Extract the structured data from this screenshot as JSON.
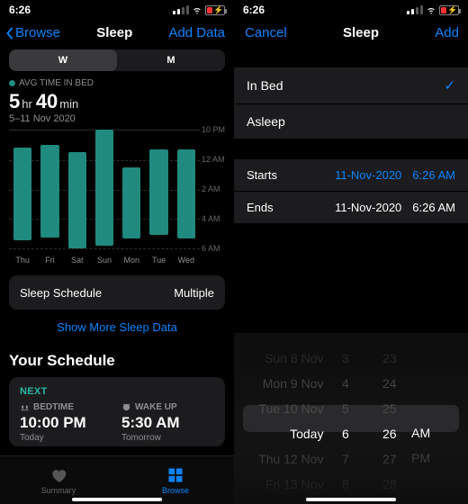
{
  "status": {
    "time": "6:26"
  },
  "left": {
    "nav": {
      "back": "Browse",
      "title": "Sleep",
      "action": "Add Data"
    },
    "seg": {
      "w": "W",
      "m": "M"
    },
    "avg_label": "AVG TIME IN BED",
    "avg_hr": "5",
    "avg_hr_unit": "hr",
    "avg_min": "40",
    "avg_min_unit": "min",
    "range": "5–11 Nov 2020",
    "schedule_row": {
      "label": "Sleep Schedule",
      "value": "Multiple"
    },
    "show_more": "Show More Sleep Data",
    "your_schedule": "Your Schedule",
    "next": "Next",
    "bed_label": "BEDTIME",
    "bed_time": "10:00 PM",
    "bed_sub": "Today",
    "wake_label": "WAKE UP",
    "wake_time": "5:30 AM",
    "wake_sub": "Tomorrow",
    "tabs": {
      "summary": "Summary",
      "browse": "Browse"
    }
  },
  "right": {
    "nav": {
      "cancel": "Cancel",
      "title": "Sleep",
      "action": "Add"
    },
    "opt_inbed": "In Bed",
    "opt_asleep": "Asleep",
    "starts": "Starts",
    "starts_date": "11-Nov-2020",
    "starts_time": "6:26 AM",
    "ends": "Ends",
    "ends_date": "11-Nov-2020",
    "ends_time": "6:26 AM",
    "picker": {
      "days": [
        "Sun 8 Nov",
        "Mon 9 Nov",
        "Tue 10 Nov",
        "Today",
        "Thu 12 Nov",
        "Fri 13 Nov"
      ],
      "hours": [
        "3",
        "4",
        "5",
        "6",
        "7",
        "8"
      ],
      "mins": [
        "23",
        "24",
        "25",
        "26",
        "27",
        "28"
      ],
      "ampm": [
        "AM",
        "PM"
      ]
    }
  },
  "chart_data": {
    "type": "bar",
    "title": "Avg time in bed",
    "categories": [
      "Thu",
      "Fri",
      "Sat",
      "Sun",
      "Mon",
      "Tue",
      "Wed"
    ],
    "y_ticks": [
      "10 PM",
      "12 AM",
      "2 AM",
      "4 AM",
      "6 AM"
    ],
    "y_axis": "time-of-day (10 PM – 6 AM, 8 h span)",
    "series": [
      {
        "name": "In Bed",
        "bars": [
          {
            "day": "Thu",
            "start": "11:10 PM",
            "end": "5:30 AM"
          },
          {
            "day": "Fri",
            "start": "11:00 PM",
            "end": "5:20 AM"
          },
          {
            "day": "Sat",
            "start": "11:30 PM",
            "end": "6:00 AM"
          },
          {
            "day": "Sun",
            "start": "10:00 PM",
            "end": "5:50 AM"
          },
          {
            "day": "Mon",
            "start": "12:30 AM",
            "end": "5:20 AM"
          },
          {
            "day": "Tue",
            "start": "11:20 PM",
            "end": "5:10 AM"
          },
          {
            "day": "Wed",
            "start": "11:20 PM",
            "end": "5:20 AM"
          }
        ]
      }
    ],
    "bars_pct": [
      {
        "top": 15,
        "height": 78
      },
      {
        "top": 13,
        "height": 78
      },
      {
        "top": 19,
        "height": 81
      },
      {
        "top": 0,
        "height": 98
      },
      {
        "top": 32,
        "height": 60
      },
      {
        "top": 17,
        "height": 72
      },
      {
        "top": 17,
        "height": 75
      }
    ]
  }
}
